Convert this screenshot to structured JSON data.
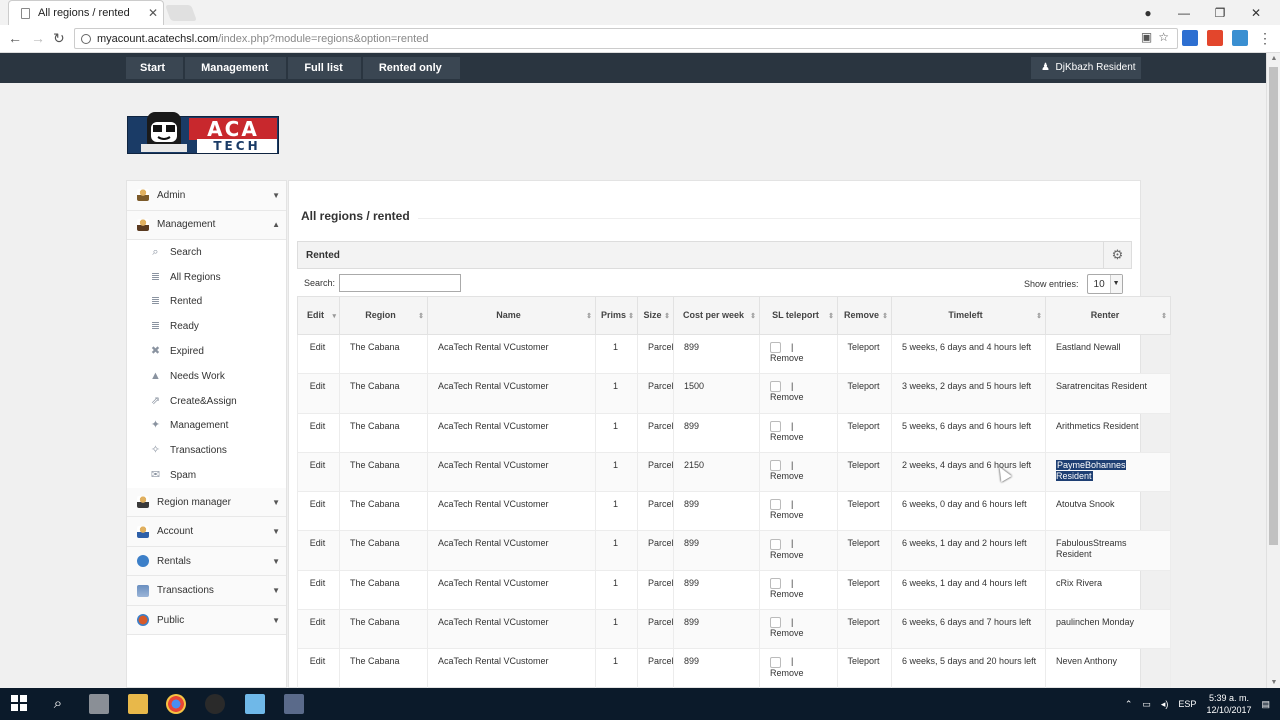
{
  "browser": {
    "tab_title": "All regions / rented",
    "url_host": "myacount.acatechsl.com",
    "url_path": "/index.php?module=regions&option=rented"
  },
  "nav": {
    "crumbs": [
      "Start",
      "Management",
      "Full list",
      "Rented only"
    ],
    "user": "DjKbazh Resident"
  },
  "logo": {
    "top": "ACA",
    "bottom": "TECH"
  },
  "sidebar": {
    "sections_top": [
      {
        "label": "Admin",
        "caret": "▼"
      },
      {
        "label": "Management",
        "caret": "▲"
      }
    ],
    "sub_items": [
      {
        "label": "Search",
        "icon": "⌕"
      },
      {
        "label": "All Regions",
        "icon": "≣"
      },
      {
        "label": "Rented",
        "icon": "≣"
      },
      {
        "label": "Ready",
        "icon": "≣"
      },
      {
        "label": "Expired",
        "icon": "✖"
      },
      {
        "label": "Needs Work",
        "icon": "▲"
      },
      {
        "label": "Create&Assign",
        "icon": "⇗"
      },
      {
        "label": "Management",
        "icon": "✦"
      },
      {
        "label": "Transactions",
        "icon": "✧"
      },
      {
        "label": "Spam",
        "icon": "✉"
      }
    ],
    "sections_bottom": [
      {
        "label": "Region manager",
        "caret": "▼"
      },
      {
        "label": "Account",
        "caret": "▼"
      },
      {
        "label": "Rentals",
        "caret": "▼"
      },
      {
        "label": "Transactions",
        "caret": "▼"
      },
      {
        "label": "Public",
        "caret": "▼"
      }
    ]
  },
  "main": {
    "title": "All regions / rented",
    "box_title": "Rented",
    "search_label": "Search:",
    "search_value": "",
    "entries_label": "Show entries:",
    "entries_value": "10"
  },
  "table": {
    "headers": [
      "Edit",
      "Region",
      "Name",
      "Prims",
      "Size",
      "Cost per week",
      "SL teleport",
      "Remove",
      "Timeleft",
      "Renter"
    ],
    "rows": [
      {
        "edit": "Edit",
        "region": "The Cabana",
        "name": "AcaTech Rental VCustomer",
        "prims": "1",
        "size": "Parcel",
        "cost": "899",
        "remove": "Remove",
        "teleport": "Teleport",
        "timeleft": "5 weeks, 6 days and 4 hours left",
        "renter": "Eastland Newall"
      },
      {
        "edit": "Edit",
        "region": "The Cabana",
        "name": "AcaTech Rental VCustomer",
        "prims": "1",
        "size": "Parcel",
        "cost": "1500",
        "remove": "Remove",
        "teleport": "Teleport",
        "timeleft": "3 weeks, 2 days and 5 hours left",
        "renter": "Saratrencitas Resident"
      },
      {
        "edit": "Edit",
        "region": "The Cabana",
        "name": "AcaTech Rental VCustomer",
        "prims": "1",
        "size": "Parcel",
        "cost": "899",
        "remove": "Remove",
        "teleport": "Teleport",
        "timeleft": "5 weeks, 6 days and 6 hours left",
        "renter": "Arithmetics Resident"
      },
      {
        "edit": "Edit",
        "region": "The Cabana",
        "name": "AcaTech Rental VCustomer",
        "prims": "1",
        "size": "Parcel",
        "cost": "2150",
        "remove": "Remove",
        "teleport": "Teleport",
        "timeleft": "2 weeks, 4 days and 6 hours left",
        "renter": "PaymeBohannes Resident"
      },
      {
        "edit": "Edit",
        "region": "The Cabana",
        "name": "AcaTech Rental VCustomer",
        "prims": "1",
        "size": "Parcel",
        "cost": "899",
        "remove": "Remove",
        "teleport": "Teleport",
        "timeleft": "6 weeks, 0 day and 6 hours left",
        "renter": "Atoutva Snook"
      },
      {
        "edit": "Edit",
        "region": "The Cabana",
        "name": "AcaTech Rental VCustomer",
        "prims": "1",
        "size": "Parcel",
        "cost": "899",
        "remove": "Remove",
        "teleport": "Teleport",
        "timeleft": "6 weeks, 1 day and 2 hours left",
        "renter": "FabulousStreams Resident"
      },
      {
        "edit": "Edit",
        "region": "The Cabana",
        "name": "AcaTech Rental VCustomer",
        "prims": "1",
        "size": "Parcel",
        "cost": "899",
        "remove": "Remove",
        "teleport": "Teleport",
        "timeleft": "6 weeks, 1 day and 4 hours left",
        "renter": "cRix Rivera"
      },
      {
        "edit": "Edit",
        "region": "The Cabana",
        "name": "AcaTech Rental VCustomer",
        "prims": "1",
        "size": "Parcel",
        "cost": "899",
        "remove": "Remove",
        "teleport": "Teleport",
        "timeleft": "6 weeks, 6 days and 7 hours left",
        "renter": "paulinchen Monday"
      },
      {
        "edit": "Edit",
        "region": "The Cabana",
        "name": "AcaTech Rental VCustomer",
        "prims": "1",
        "size": "Parcel",
        "cost": "899",
        "remove": "Remove",
        "teleport": "Teleport",
        "timeleft": "6 weeks, 5 days and 20 hours left",
        "renter": "Neven Anthony"
      }
    ]
  },
  "taskbar": {
    "lang": "ESP",
    "time": "5:39 a. m.",
    "date": "12/10/2017"
  }
}
